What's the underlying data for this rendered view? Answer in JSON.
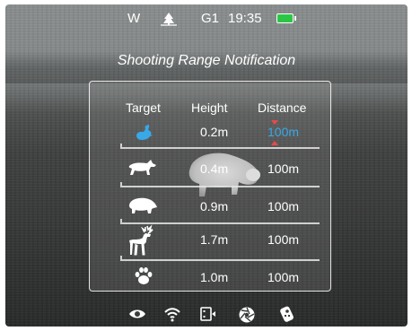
{
  "status": {
    "mode": "W",
    "gain": "G1",
    "time": "19:35",
    "battery_color": "#2cc646",
    "icons": [
      "forest-mode-icon",
      "battery-icon"
    ]
  },
  "title": "Shooting Range Notification",
  "table": {
    "headers": {
      "target": "Target",
      "height": "Height",
      "distance": "Distance"
    },
    "rows": [
      {
        "icon": "rabbit-icon",
        "height": "0.2m",
        "distance": "100m",
        "selected": true
      },
      {
        "icon": "wolf-icon",
        "height": "0.4m",
        "distance": "100m",
        "selected": false
      },
      {
        "icon": "boar-icon",
        "height": "0.9m",
        "distance": "100m",
        "selected": false
      },
      {
        "icon": "deer-icon",
        "height": "1.7m",
        "distance": "100m",
        "selected": false
      },
      {
        "icon": "paw-icon",
        "height": "1.0m",
        "distance": "100m",
        "selected": false
      }
    ],
    "active_color": "#39a8e8"
  },
  "bottom_icons": [
    "eye-icon",
    "wifi-icon",
    "video-record-icon",
    "photo-shutter-icon",
    "remote-icon"
  ]
}
